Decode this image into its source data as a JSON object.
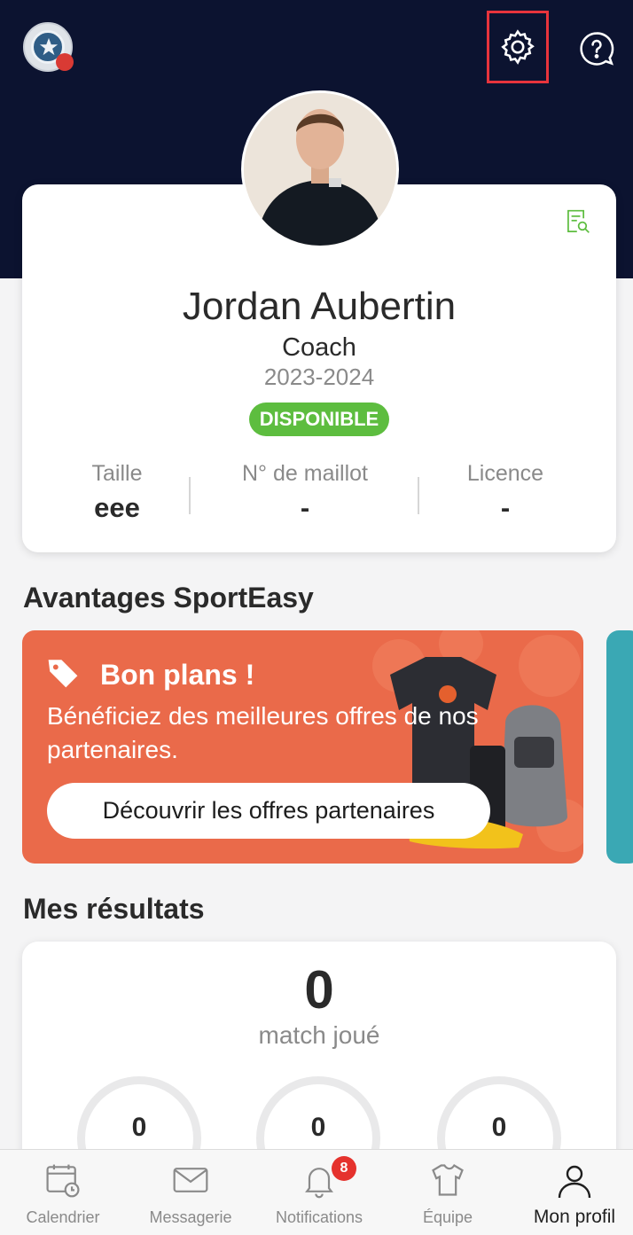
{
  "header": {
    "team_logo": "team-crest-logo",
    "settings_icon": "gear-icon",
    "help_icon": "help-bubble-icon",
    "accent": "#e8343c",
    "background": "#0c1330"
  },
  "profile": {
    "name": "Jordan Aubertin",
    "role": "Coach",
    "season": "2023-2024",
    "status": "DISPONIBLE",
    "status_color": "#5dbd3f",
    "stats": [
      {
        "label": "Taille",
        "value": "eee"
      },
      {
        "label": "N° de maillot",
        "value": "-"
      },
      {
        "label": "Licence",
        "value": "-"
      }
    ]
  },
  "advantages": {
    "title": "Avantages SportEasy",
    "promo_title": "Bon plans !",
    "promo_text": "Bénéficiez des meilleures offres de nos partenaires.",
    "promo_cta": "Découvrir les offres partenaires",
    "promo_color": "#ea6a4a"
  },
  "results": {
    "title": "Mes résultats",
    "matches_count": "0",
    "matches_label": "match joué",
    "rings": [
      "0",
      "0",
      "0"
    ]
  },
  "nav": {
    "items": [
      {
        "label": "Calendrier",
        "icon": "calendar-icon"
      },
      {
        "label": "Messagerie",
        "icon": "mail-icon"
      },
      {
        "label": "Notifications",
        "icon": "bell-icon"
      },
      {
        "label": "Équipe",
        "icon": "jersey-icon"
      },
      {
        "label": "Mon profil",
        "icon": "user-icon"
      }
    ],
    "notification_count": "8",
    "active": "Mon profil"
  }
}
